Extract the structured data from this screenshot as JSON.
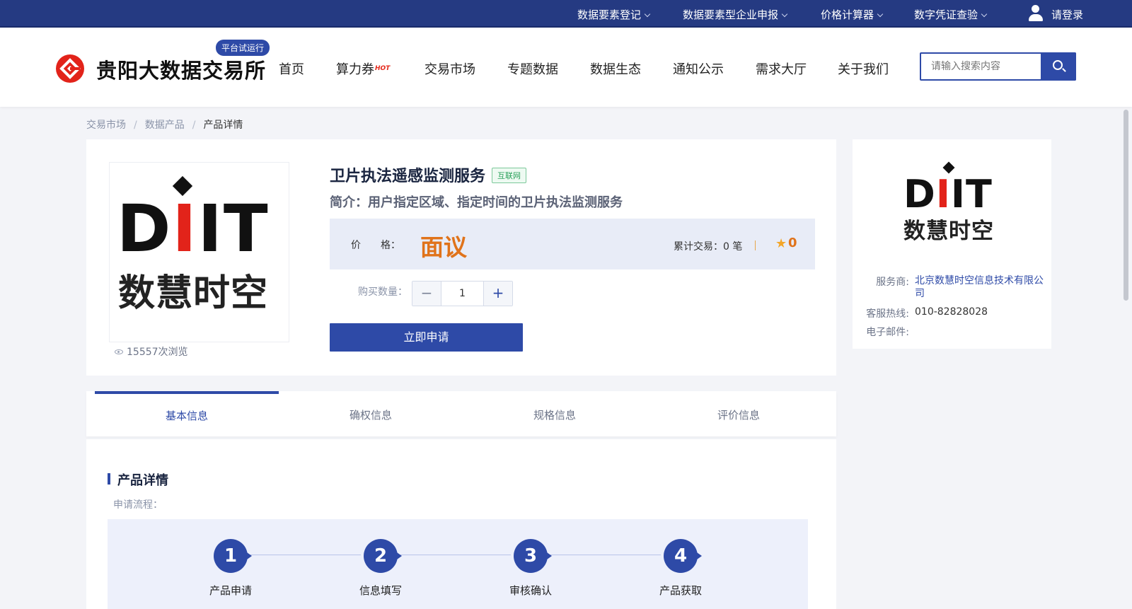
{
  "topbar": {
    "items": [
      "数据要素登记",
      "数据要素型企业申报",
      "价格计算器",
      "数字凭证查验"
    ],
    "login": "请登录"
  },
  "header": {
    "logo_text": "贵阳大数据交易所",
    "trial_badge": "平台试运行",
    "nav": [
      "首页",
      "算力券",
      "交易市场",
      "专题数据",
      "数据生态",
      "通知公示",
      "需求大厅",
      "关于我们"
    ],
    "hot_tag": "HOT",
    "search_placeholder": "请输入搜索内容"
  },
  "breadcrumb": [
    "交易市场",
    "数据产品",
    "产品详情"
  ],
  "product": {
    "logo_brand": "DIIT",
    "logo_sub": "数慧时空",
    "views": "15557次浏览",
    "title": "卫片执法遥感监测服务",
    "tag": "互联网",
    "intro": "简介：用户指定区域、指定时间的卫片执法监测服务",
    "price_label": "价　　格：",
    "price_value": "面议",
    "trade_count": "累计交易：0 笔",
    "rating": "0",
    "qty_label": "购买数量：",
    "qty_minus": "−",
    "qty_value": "1",
    "qty_plus": "+",
    "apply_button": "立即申请"
  },
  "provider": {
    "logo_brand": "DIIT",
    "logo_sub": "数慧时空",
    "rows": [
      {
        "key": "服务商:",
        "value": "北京数慧时空信息技术有限公司"
      },
      {
        "key": "客服热线:",
        "value": "010-82828028"
      },
      {
        "key": "电子邮件:",
        "value": ""
      }
    ]
  },
  "tabs": [
    "基本信息",
    "确权信息",
    "规格信息",
    "评价信息"
  ],
  "details": {
    "section_title": "产品详情",
    "process_label": "申请流程：",
    "steps": [
      {
        "num": "1",
        "label": "产品申请"
      },
      {
        "num": "2",
        "label": "信息填写"
      },
      {
        "num": "3",
        "label": "审核确认"
      },
      {
        "num": "4",
        "label": "产品获取"
      }
    ]
  },
  "colors": {
    "brand_blue": "#2e4aa7",
    "topbar": "#253a82",
    "price_orange": "#e0731a",
    "logo_red": "#e2231a"
  }
}
